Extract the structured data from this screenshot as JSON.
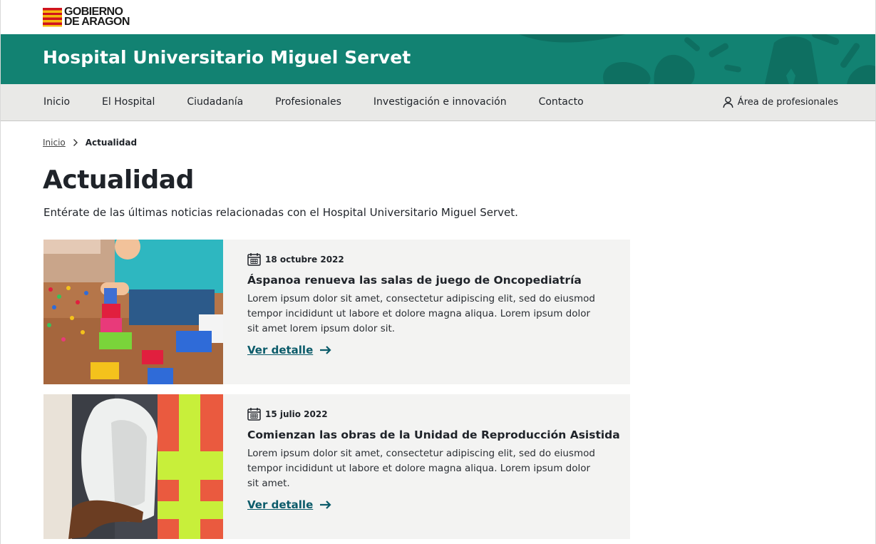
{
  "brand": {
    "logo_line1": "GOBIERNO",
    "logo_line2": "DE ARAGON"
  },
  "hero": {
    "title": "Hospital Universitario Miguel Servet"
  },
  "nav": {
    "items": [
      "Inicio",
      "El Hospital",
      "Ciudadanía",
      "Profesionales",
      "Investigación e innovación",
      "Contacto"
    ],
    "professionals": "Área de profesionales"
  },
  "breadcrumb": {
    "home": "Inicio",
    "current": "Actualidad"
  },
  "page": {
    "title": "Actualidad",
    "intro": "Entérate de las últimas noticias relacionadas con el Hospital Universitario Miguel Servet."
  },
  "news": [
    {
      "date": "18 octubre 2022",
      "title": "Áspanoa renueva las salas de juego de Oncopediatría",
      "text": "Lorem ipsum dolor sit amet, consectetur adipiscing elit, sed do eiusmod tempor incididunt ut labore et dolore magna aliqua.  Lorem ipsum dolor sit amet lorem ipsum dolor sit.",
      "link": "Ver detalle"
    },
    {
      "date": "15 julio 2022",
      "title": "Comienzan las obras de la Unidad de Reproducción Asistida",
      "text": "Lorem ipsum dolor sit amet, consectetur adipiscing elit, sed do eiusmod tempor incididunt ut labore et dolore magna aliqua.  Lorem ipsum dolor sit amet.",
      "link": "Ver detalle"
    }
  ],
  "colors": {
    "brand_green": "#128272",
    "link": "#0b5b6a",
    "nav_bg": "#e9e9e7",
    "card_bg": "#f3f3f2"
  }
}
